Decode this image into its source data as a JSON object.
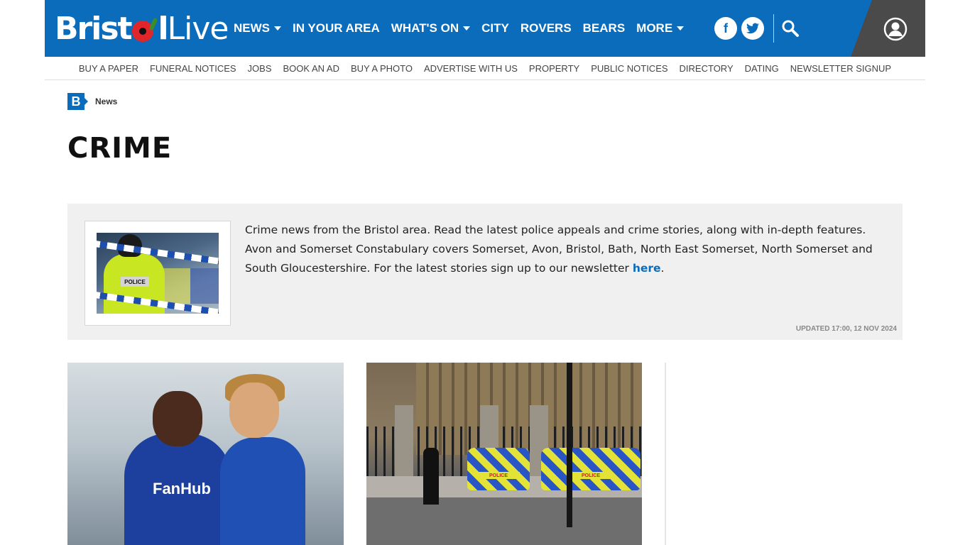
{
  "brand": {
    "name_part1": "Brist",
    "name_part2": "l",
    "name_part3": "Live"
  },
  "nav": {
    "items": [
      {
        "label": "NEWS",
        "dropdown": true
      },
      {
        "label": "IN YOUR AREA",
        "dropdown": false
      },
      {
        "label": "WHAT'S ON",
        "dropdown": true
      },
      {
        "label": "CITY",
        "dropdown": false
      },
      {
        "label": "ROVERS",
        "dropdown": false
      },
      {
        "label": "BEARS",
        "dropdown": false
      },
      {
        "label": "MORE",
        "dropdown": true
      }
    ],
    "facebook_glyph": "f",
    "icons": [
      "facebook-icon",
      "twitter-icon",
      "search-icon",
      "account-icon"
    ]
  },
  "subnav": {
    "items": [
      "BUY A PAPER",
      "FUNERAL NOTICES",
      "JOBS",
      "BOOK AN AD",
      "BUY A PHOTO",
      "ADVERTISE WITH US",
      "PROPERTY",
      "PUBLIC NOTICES",
      "DIRECTORY",
      "DATING",
      "NEWSLETTER SIGNUP"
    ]
  },
  "breadcrumb": {
    "badge": "B",
    "label": "News"
  },
  "page": {
    "title": "CRIME"
  },
  "intro": {
    "text": "Crime news from the Bristol area. Read the latest police appeals and crime stories, along with in-depth features. Avon and Somerset Constabulary covers Somerset, Avon, Bristol, Bath, North East Somerset, North Somerset and South Gloucestershire. For the latest stories sign up to our newsletter ",
    "link_text": "here",
    "after_link": ".",
    "updated": "UPDATED  17:00, 12 NOV 2024",
    "image_patch_text": "POLICE"
  },
  "cards": {
    "card1_kit_text": "FanHub",
    "card2_car_label": "POLICE"
  },
  "colors": {
    "brand_blue": "#0a6cba",
    "account_grey": "#4a4a4a",
    "intro_bg": "#f0f0f0"
  }
}
